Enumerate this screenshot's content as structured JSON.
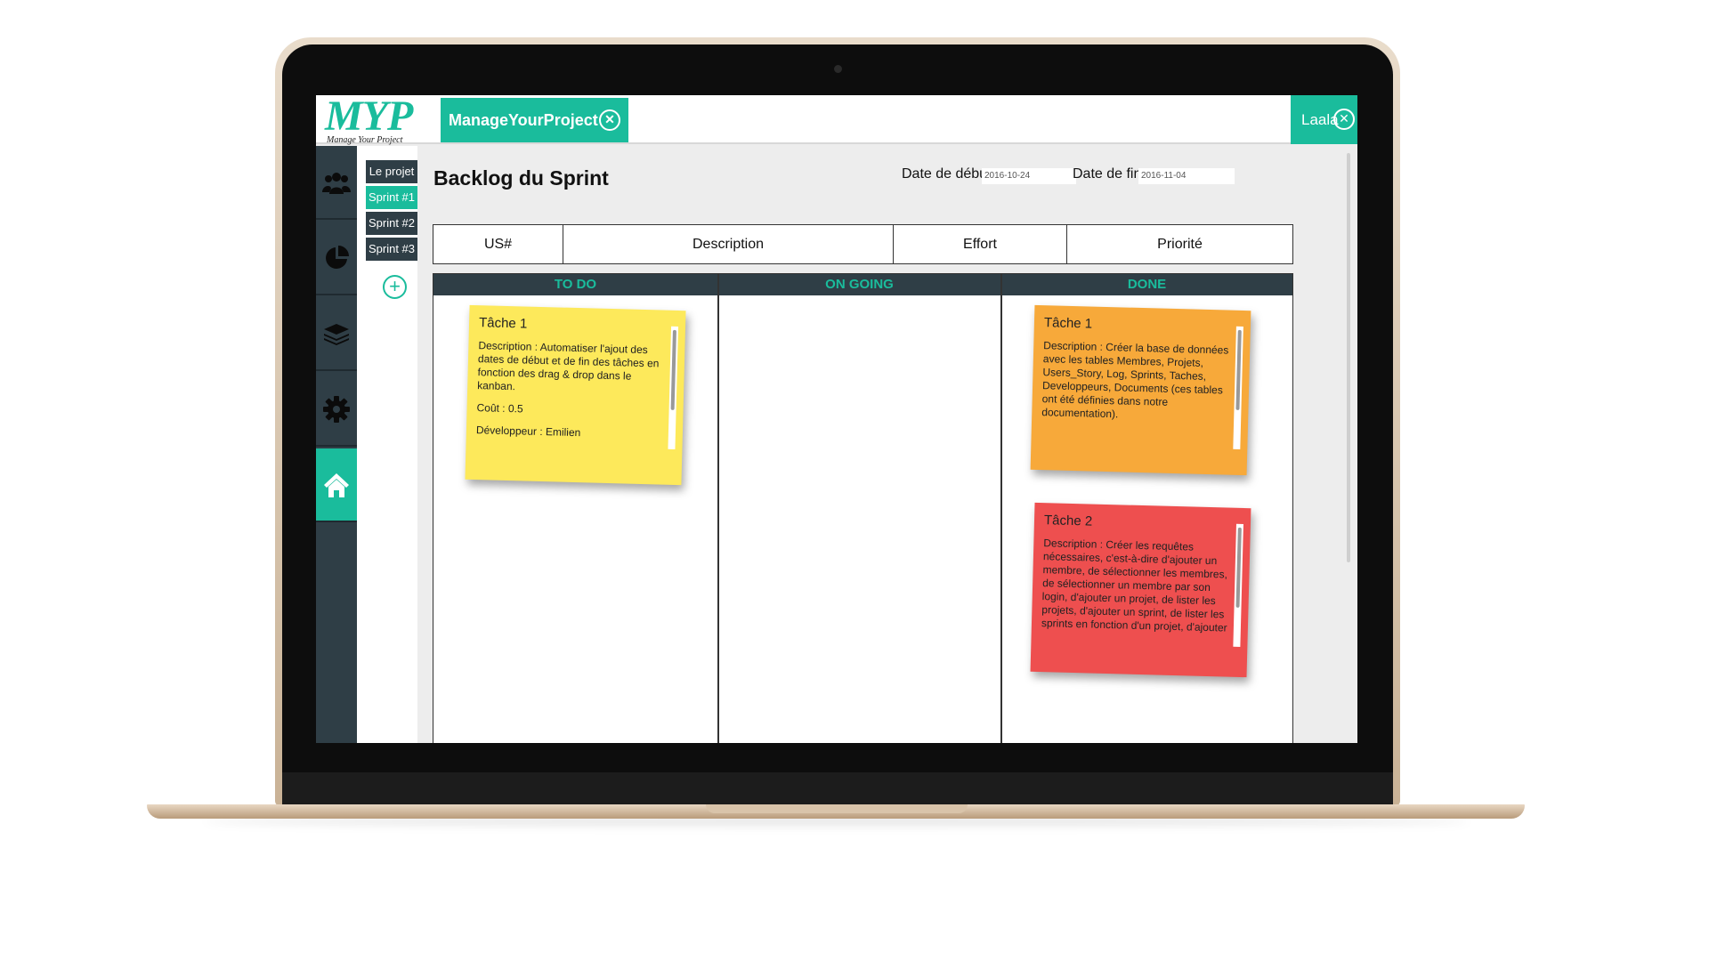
{
  "app": {
    "logo_text": "MYP",
    "logo_subtitle": "Manage Your Project",
    "project_tab_label": "ManageYourProject",
    "user_name": "Laala"
  },
  "colors": {
    "accent": "#1abc9c",
    "nav_dark": "#2f3e46",
    "note_yellow": "#fde95b",
    "note_orange": "#f7a93a",
    "note_red": "#ee4f4f"
  },
  "left_nav": [
    {
      "icon": "users-icon",
      "active": false
    },
    {
      "icon": "pie-chart-icon",
      "active": false
    },
    {
      "icon": "layers-icon",
      "active": false
    },
    {
      "icon": "gear-icon",
      "active": false
    },
    {
      "icon": "home-icon",
      "active": true
    }
  ],
  "sprint_nav": {
    "items": [
      "Le projet",
      "Sprint #1",
      "Sprint #2",
      "Sprint #3"
    ],
    "active": "Sprint #1",
    "add_label": "+"
  },
  "page": {
    "title": "Backlog du Sprint",
    "start_label": "Date de début",
    "start_value": "2016-10-24",
    "end_label": "Date de fin",
    "end_value": "2016-11-04"
  },
  "us_table": {
    "headers": [
      "US#",
      "Description",
      "Effort",
      "Priorité"
    ]
  },
  "kanban": {
    "columns": [
      "TO DO",
      "ON GOING",
      "DONE"
    ],
    "todo_notes": [
      {
        "title": "Tâche 1",
        "description": "Description : Automatiser l'ajout des dates de début et de fin des tâches en fonction des drag & drop dans le kanban.",
        "cost": "Coût : 0.5",
        "developer": "Développeur : Emilien"
      }
    ],
    "done_notes": [
      {
        "title": "Tâche 1",
        "description": "Description : Créer la base de données avec les tables Membres, Projets, Users_Story, Log, Sprints, Taches, Developpeurs, Documents (ces tables ont été définies dans notre documentation)."
      },
      {
        "title": "Tâche 2",
        "description": "Description : Créer les requêtes nécessaires, c'est-à-dire d'ajouter un membre, de sélectionner les membres, de sélectionner un membre par son login, d'ajouter un projet, de lister les projets, d'ajouter un sprint, de lister les sprints en fonction d'un projet, d'ajouter"
      }
    ]
  }
}
